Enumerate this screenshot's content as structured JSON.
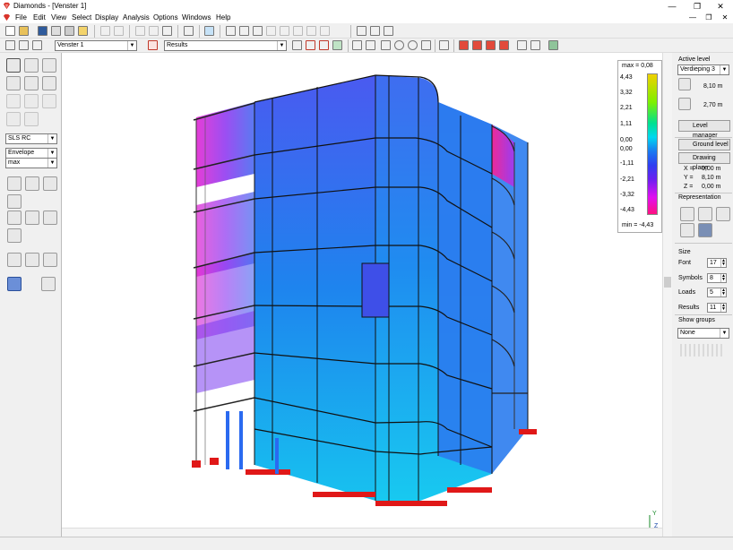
{
  "app": {
    "title": "Diamonds - [Venster 1]",
    "brand_color": "#c0392b"
  },
  "window_controls": {
    "minimize": "—",
    "restore": "❐",
    "close": "✕",
    "inner_minimize": "—",
    "inner_restore": "❐",
    "inner_close": "✕"
  },
  "menu": {
    "items": [
      "File",
      "Edit",
      "View",
      "Select",
      "Display",
      "Analysis",
      "Options",
      "Windows",
      "Help"
    ]
  },
  "toolbar2": {
    "window_select": "Venster 1",
    "results_select": "Results"
  },
  "left_panel": {
    "combination": "SLS RC",
    "envelope": "Envelope",
    "extreme": "max"
  },
  "legend": {
    "max_label": "max = 0,08",
    "min_label": "min = -4,43",
    "ticks": [
      "4,43",
      "3,32",
      "2,21",
      "1,11",
      "0,00",
      "0,00",
      "-1,11",
      "-2,21",
      "-3,32",
      "-4,43"
    ]
  },
  "right_panel": {
    "active_level_title": "Active level",
    "level_select": "Verdieping 3",
    "level_height": "8,10 m",
    "floor_height": "2,70 m",
    "level_manager": "Level manager",
    "ground_level": "Ground level",
    "drawing_plane": "Drawing plane",
    "x_label": "X =",
    "x_value": "0,00 m",
    "y_label": "Y =",
    "y_value": "8,10 m",
    "z_label": "Z =",
    "z_value": "0,00 m",
    "representation_title": "Representation",
    "size_title": "Size",
    "font_label": "Font",
    "font_value": "17",
    "symbols_label": "Symbols",
    "symbols_value": "8",
    "loads_label": "Loads",
    "loads_value": "5",
    "results_label": "Results",
    "results_value": "11",
    "show_groups_title": "Show groups",
    "groups_select": "None"
  },
  "axes": {
    "y": "Y",
    "z": "Z"
  }
}
